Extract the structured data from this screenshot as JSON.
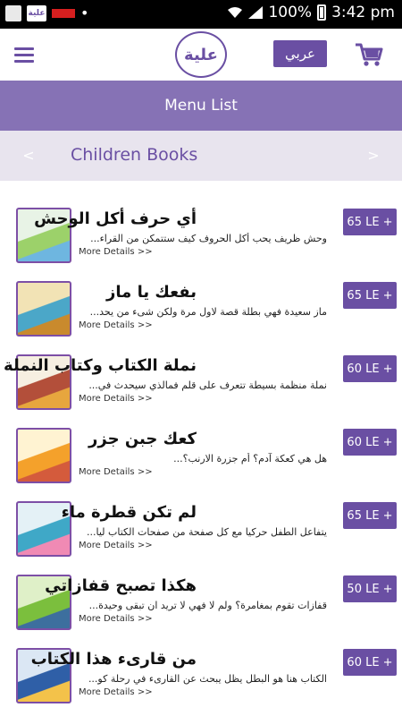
{
  "status_bar": {
    "time": "3:42 pm",
    "battery": "100%"
  },
  "header": {
    "logo_text": "علية",
    "language_button": "عربي"
  },
  "title_bar": {
    "title": "Menu List"
  },
  "category_bar": {
    "prev": "<",
    "next": ">",
    "title": "Children Books"
  },
  "books": [
    {
      "title": "أي حرف أكل الوحش",
      "description": "وحش ظريف يحب أكل الحروف كيف ستتمكن من القراء...",
      "more": "More Details >>",
      "price": "65 LE +",
      "cover_colors": [
        "#e8f3e6",
        "#9cd16a",
        "#6eb6e0"
      ]
    },
    {
      "title": "بفعك يا ماز",
      "description": "ماز سعيدة فهي بطلة قصة لاول مرة ولكن شىء من يحد...",
      "more": "More Details >>",
      "price": "65 LE +",
      "cover_colors": [
        "#f2e3b5",
        "#4ba7c8",
        "#c98a2d"
      ]
    },
    {
      "title": "نملة الكتاب وكتاب النملة",
      "description": "نملة منظمة بسيطة تتعرف على قلم فمالذي سيحدث في...",
      "more": "More Details >>",
      "price": "60 LE +",
      "cover_colors": [
        "#f6efe1",
        "#b34f3a",
        "#e7a63e"
      ]
    },
    {
      "title": "كعك جبن جزر",
      "description": "هل هي كعكة آدم؟ أم جزرة الارنب؟...",
      "more": "More Details >>",
      "price": "60 LE +",
      "cover_colors": [
        "#fff3d2",
        "#f4a12b",
        "#d45b3c"
      ]
    },
    {
      "title": "لم تكن قطرة ماء",
      "description": "يتفاعل الطفل حركيا مع كل صفحة من صفحات الكتاب ليا...",
      "more": "More Details >>",
      "price": "65 LE +",
      "cover_colors": [
        "#e4f1f6",
        "#3fa8c7",
        "#f08ab4"
      ]
    },
    {
      "title": "هكذا تصبح قفازاتي",
      "description": "قفازات تقوم بمغامرة؟ ولم لا فهي لا تريد ان تبقى وحيدة...",
      "more": "More Details >>",
      "price": "50 LE +",
      "cover_colors": [
        "#dff0c8",
        "#7bbf3d",
        "#3d6f9e"
      ]
    },
    {
      "title": "من قارىء هذا الكتاب",
      "description": "الكتاب هنا هو البطل يظل يبحث عن القارىء في رحلة كو...",
      "more": "More Details >>",
      "price": "60 LE +",
      "cover_colors": [
        "#dbe7f4",
        "#2f5fa7",
        "#f3c24a"
      ]
    }
  ]
}
